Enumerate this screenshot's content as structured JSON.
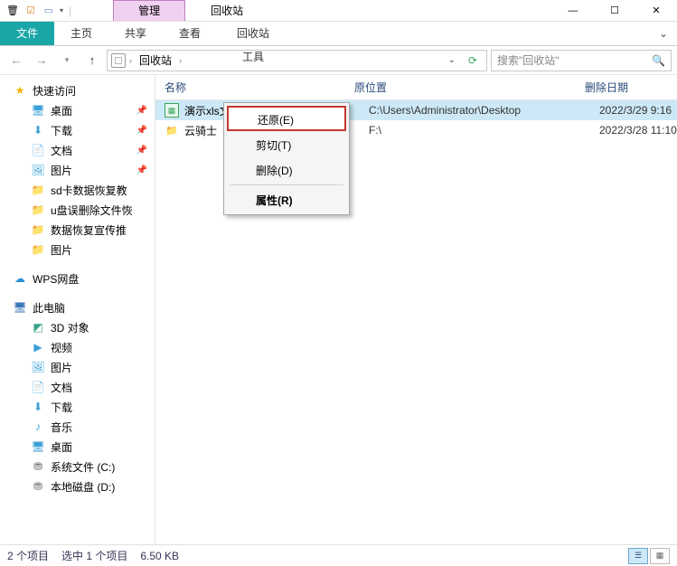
{
  "window": {
    "title": "回收站",
    "contextual_tab": "管理",
    "controls": {
      "min": "—",
      "max": "☐",
      "close": "✕"
    }
  },
  "ribbon": {
    "file": "文件",
    "tabs": [
      "主页",
      "共享",
      "查看"
    ],
    "context_tool": "回收站工具"
  },
  "nav": {
    "crumb_root": "回收站",
    "search_placeholder": "搜索\"回收站\""
  },
  "sidebar": {
    "quick_access": "快速访问",
    "quick_items": [
      {
        "icon": "desktop",
        "label": "桌面",
        "pin": true
      },
      {
        "icon": "down",
        "label": "下载",
        "pin": true
      },
      {
        "icon": "doc",
        "label": "文档",
        "pin": true
      },
      {
        "icon": "pic",
        "label": "图片",
        "pin": true
      },
      {
        "icon": "folder",
        "label": "sd卡数据恢复教"
      },
      {
        "icon": "folder",
        "label": "u盘误删除文件恢"
      },
      {
        "icon": "folder",
        "label": "数据恢复宣传推"
      },
      {
        "icon": "folder",
        "label": "图片"
      }
    ],
    "wps": "WPS网盘",
    "this_pc": "此电脑",
    "pc_items": [
      {
        "icon": "obj3d",
        "label": "3D 对象"
      },
      {
        "icon": "video",
        "label": "视频"
      },
      {
        "icon": "pic",
        "label": "图片"
      },
      {
        "icon": "doc",
        "label": "文档"
      },
      {
        "icon": "down",
        "label": "下载"
      },
      {
        "icon": "music",
        "label": "音乐"
      },
      {
        "icon": "desktop",
        "label": "桌面"
      },
      {
        "icon": "drive",
        "label": "系统文件 (C:)"
      },
      {
        "icon": "drive",
        "label": "本地磁盘 (D:)"
      }
    ]
  },
  "columns": {
    "name": "名称",
    "orig": "原位置",
    "date": "删除日期"
  },
  "files": [
    {
      "icon": "xls",
      "name": "演示xls文件",
      "orig": "C:\\Users\\Administrator\\Desktop",
      "date": "2022/3/29 9:16",
      "selected": true
    },
    {
      "icon": "fold",
      "name": "云骑士",
      "orig": "F:\\",
      "date": "2022/3/28 11:10",
      "selected": false
    }
  ],
  "context_menu": {
    "items": [
      {
        "label": "还原(E)",
        "hi": true
      },
      {
        "label": "剪切(T)"
      },
      {
        "label": "删除(D)"
      },
      {
        "sep": true
      },
      {
        "label": "属性(R)",
        "bold": true
      }
    ]
  },
  "status": {
    "count": "2 个项目",
    "selected": "选中 1 个项目",
    "size": "6.50 KB"
  }
}
